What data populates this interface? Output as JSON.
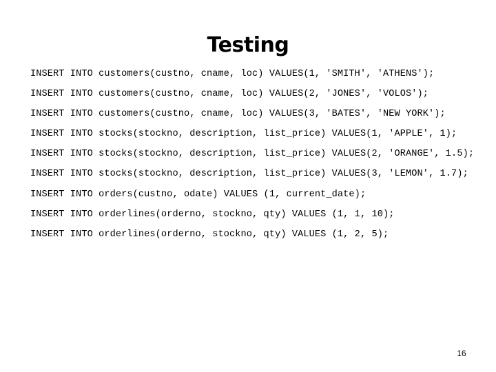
{
  "slide": {
    "title": "Testing",
    "page_number": "16"
  },
  "code": {
    "lines": [
      "INSERT INTO customers(custno, cname, loc) VALUES(1, 'SMITH', 'ATHENS');",
      "INSERT INTO customers(custno, cname, loc) VALUES(2, 'JONES', 'VOLOS');",
      "INSERT INTO customers(custno, cname, loc) VALUES(3, 'BATES', 'NEW YORK');",
      "INSERT INTO stocks(stockno, description, list_price) VALUES(1, 'APPLE', 1);",
      "INSERT INTO stocks(stockno, description, list_price) VALUES(2, 'ORANGE', 1.5);",
      "INSERT INTO stocks(stockno, description, list_price) VALUES(3, 'LEMON', 1.7);",
      "INSERT INTO orders(custno, odate) VALUES (1, current_date);",
      "INSERT INTO orderlines(orderno, stockno, qty) VALUES (1, 1, 10);",
      "INSERT INTO orderlines(orderno, stockno, qty) VALUES (1, 2, 5);"
    ]
  }
}
